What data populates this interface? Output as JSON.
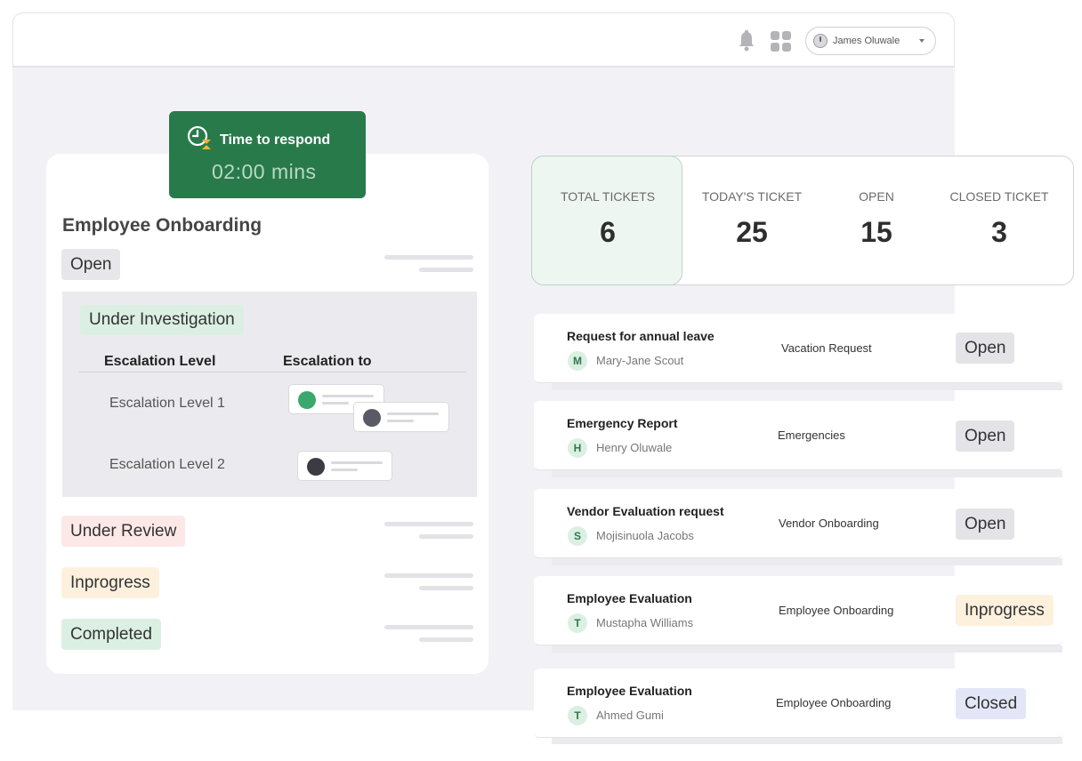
{
  "header": {
    "user_name": "James Oluwale"
  },
  "timer": {
    "label": "Time to respond",
    "value": "02:00 mins"
  },
  "onboarding_card": {
    "title": "Employee Onboarding",
    "status_open": "Open",
    "investigation": {
      "status": "Under Investigation",
      "column_level": "Escalation Level",
      "column_to": "Escalation to",
      "levels": [
        {
          "label": "Escalation Level 1"
        },
        {
          "label": "Escalation Level 2"
        }
      ]
    },
    "status_review": "Under Review",
    "status_inprogress": "Inprogress",
    "status_completed": "Completed"
  },
  "stats": [
    {
      "label": "TOTAL TICKETS",
      "value": "6"
    },
    {
      "label": "TODAY'S TICKET",
      "value": "25"
    },
    {
      "label": "OPEN",
      "value": "15"
    },
    {
      "label": "CLOSED TICKET",
      "value": "3"
    }
  ],
  "tickets": [
    {
      "title": "Request for annual leave",
      "initial": "M",
      "person": "Mary-Jane Scout",
      "category": "Vacation Request",
      "status": "Open"
    },
    {
      "title": "Emergency Report",
      "initial": "H",
      "person": "Henry Oluwale",
      "category": "Emergencies",
      "status": "Open"
    },
    {
      "title": "Vendor Evaluation request",
      "initial": "S",
      "person": "Mojisinuola Jacobs",
      "category": "Vendor Onboarding",
      "status": "Open"
    },
    {
      "title": "Employee Evaluation",
      "initial": "T",
      "person": "Mustapha Williams",
      "category": "Employee Onboarding",
      "status": "Inprogress"
    },
    {
      "title": "Employee Evaluation",
      "initial": "T",
      "person": "Ahmed Gumi",
      "category": "Employee Onboarding",
      "status": "Closed"
    }
  ],
  "colors": {
    "accent_green": "#287a4a",
    "timer_text": "#b9d8c6",
    "open_chip": "#e4e4e8",
    "review_chip": "#fde8e8",
    "progress_chip": "#fdf1de",
    "completed_chip": "#dcefe3",
    "closed_chip": "#e3e6f6"
  }
}
